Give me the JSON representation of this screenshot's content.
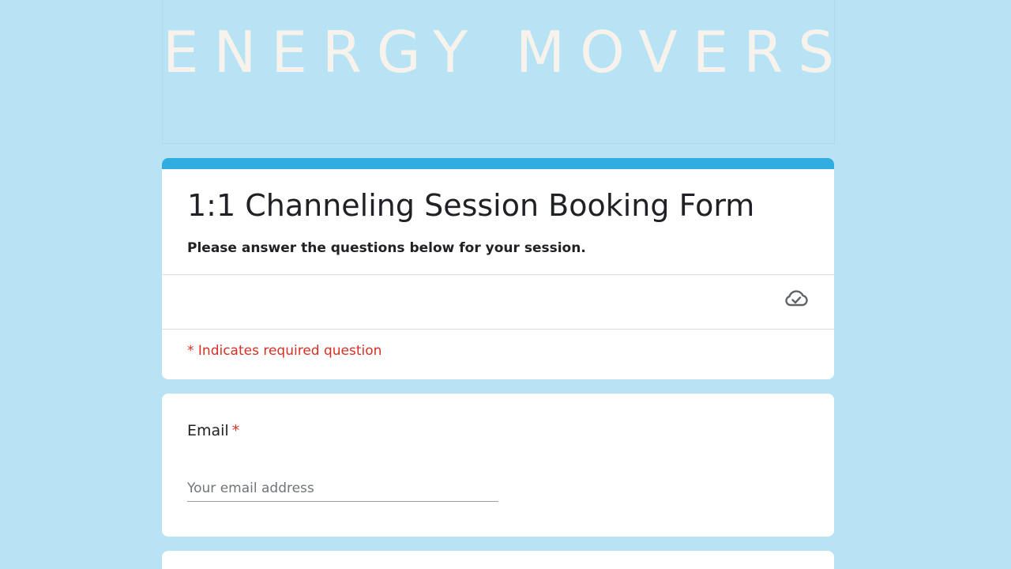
{
  "colors": {
    "background": "#b7e3f5",
    "accent": "#30ace0",
    "required": "#d93025",
    "header_text": "#f7f3ec"
  },
  "header": {
    "banner_text": "ENERGY MOVERS"
  },
  "form": {
    "title": "1:1 Channeling Session Booking Form",
    "description": "Please answer the questions below for your session.",
    "save_status_icon": "cloud-check-icon",
    "required_note": "* Indicates required question"
  },
  "questions": [
    {
      "label": "Email",
      "required_marker": "*",
      "placeholder": "Your email address",
      "value": ""
    }
  ]
}
